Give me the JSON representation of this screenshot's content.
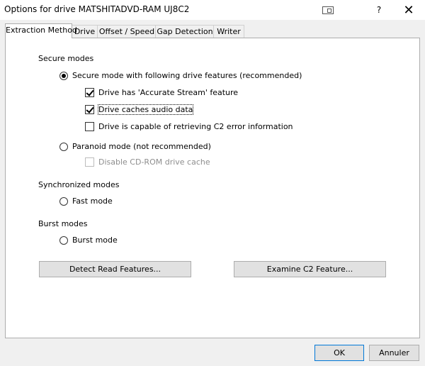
{
  "window": {
    "title": "Options for drive MATSHITADVD-RAM UJ8C2",
    "help_label": "?",
    "close_label": "✕"
  },
  "tabs": [
    "Extraction Method",
    "Drive",
    "Offset / Speed",
    "Gap Detection",
    "Writer"
  ],
  "active_tab": "Extraction Method",
  "secure": {
    "heading": "Secure modes",
    "secure_mode_label": "Secure mode with following drive features (recommended)",
    "accurate_stream_label": "Drive has 'Accurate Stream' feature",
    "caches_audio_label": "Drive caches audio data",
    "c2_label": "Drive is capable of retrieving C2 error information",
    "paranoid_label": "Paranoid mode (not recommended)",
    "disable_cache_label": "Disable CD-ROM drive cache"
  },
  "synchronized": {
    "heading": "Synchronized modes",
    "fast_label": "Fast mode"
  },
  "burst": {
    "heading": "Burst modes",
    "burst_label": "Burst mode"
  },
  "buttons": {
    "detect": "Detect Read Features...",
    "examine": "Examine C2 Feature...",
    "ok": "OK",
    "cancel": "Annuler"
  },
  "state": {
    "selected_mode": "secure",
    "accurate_stream": true,
    "caches_audio": true,
    "c2": false,
    "disable_cache": false,
    "disable_cache_enabled": false
  }
}
